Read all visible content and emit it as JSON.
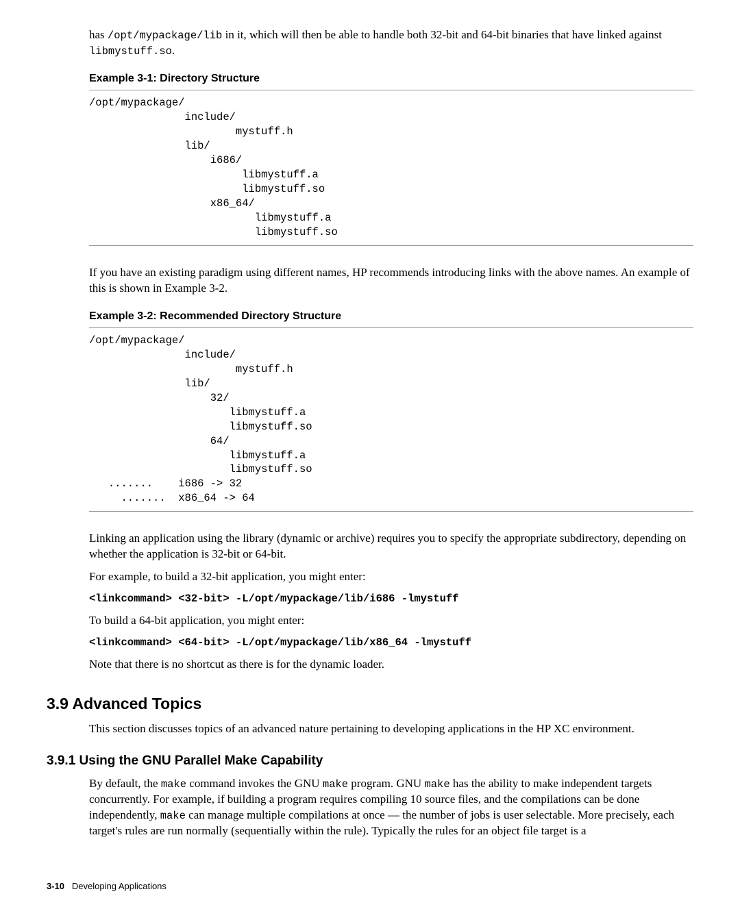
{
  "intro": {
    "p1a": "has ",
    "p1code": "/opt/mypackage/lib",
    "p1b": " in it, which will then be able to handle both 32-bit and 64-bit binaries that have linked against ",
    "p1code2": "libmystuff.so",
    "p1c": "."
  },
  "ex1": {
    "title": "Example 3-1:  Directory Structure",
    "code": "/opt/mypackage/\n               include/\n                       mystuff.h\n               lib/\n                   i686/\n                        libmystuff.a\n                        libmystuff.so\n                   x86_64/\n                          libmystuff.a\n                          libmystuff.so"
  },
  "between": "If you have an existing paradigm using different names, HP recommends introducing links with the above names.  An example of this is shown in Example 3-2.",
  "ex2": {
    "title": "Example 3-2:  Recommended Directory Structure",
    "code": "/opt/mypackage/\n               include/\n                       mystuff.h\n               lib/\n                   32/\n                      libmystuff.a\n                      libmystuff.so\n                   64/\n                      libmystuff.a\n                      libmystuff.so\n   .......    i686 -> 32\n     .......  x86_64 -> 64"
  },
  "after": {
    "p1": "Linking an application using the library (dynamic or archive) requires you to specify the appropriate subdirectory, depending on whether the application is 32-bit or 64-bit.",
    "p2": "For example, to build a 32-bit application, you might enter:",
    "cmd1": "<linkcommand> <32-bit> -L/opt/mypackage/lib/i686 -lmystuff",
    "p3": "To build a 64-bit application, you might enter:",
    "cmd2": "<linkcommand> <64-bit> -L/opt/mypackage/lib/x86_64 -lmystuff",
    "p4": "Note that there is no shortcut as there is for the dynamic loader."
  },
  "sec39": {
    "heading": "3.9  Advanced Topics",
    "p1": "This section discusses topics of an advanced nature pertaining to developing applications in the HP XC environment."
  },
  "sec391": {
    "heading": "3.9.1  Using the GNU Parallel Make Capability",
    "p1a": "By default, the ",
    "c1": "make",
    "p1b": " command invokes the GNU ",
    "c2": "make",
    "p1c": " program.  GNU ",
    "c3": "make",
    "p1d": " has the ability to make independent targets concurrently.  For example, if building a program requires compiling 10 source files, and the compilations can be done independently, ",
    "c4": "make",
    "p1e": " can manage multiple compilations at once — the number of jobs is user selectable.  More precisely, each target's rules are run normally (sequentially within the rule).  Typically the rules for an object file target is a"
  },
  "footer": {
    "page": "3-10",
    "label": "Developing Applications"
  }
}
